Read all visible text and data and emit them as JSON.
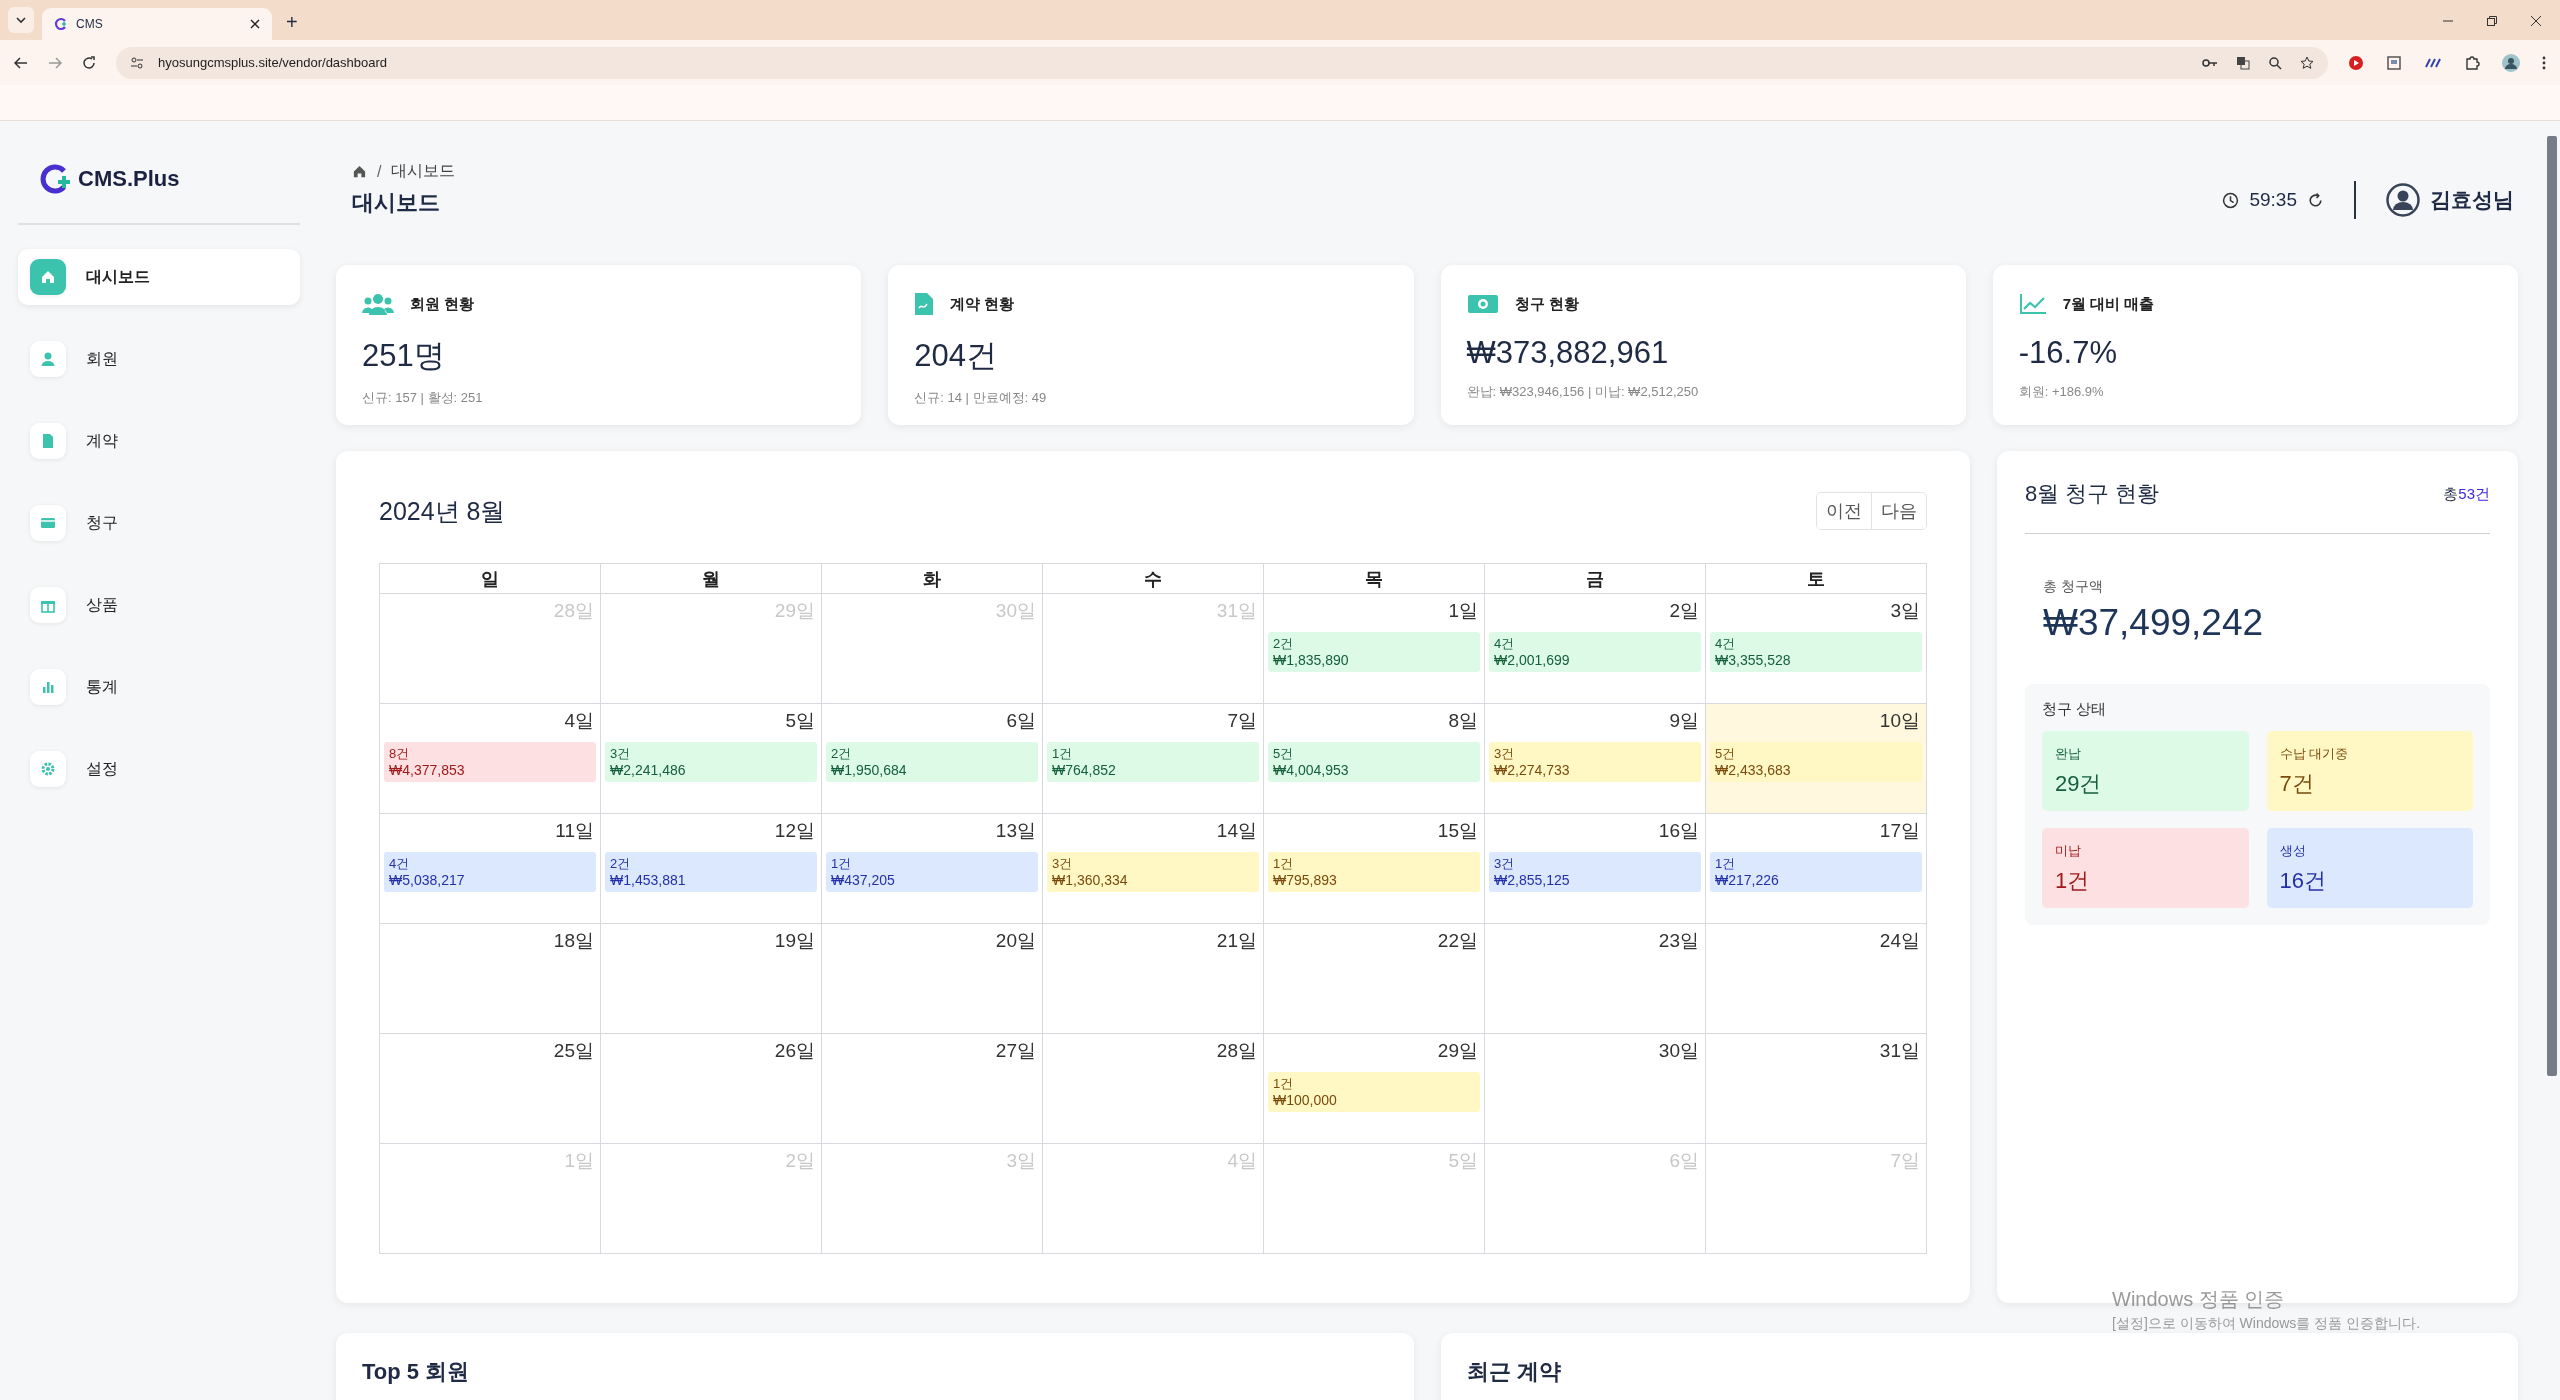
{
  "browser": {
    "tab_title": "CMS",
    "new_tab": "+",
    "url": "hyosungcmsplus.site/vendor/dashboard"
  },
  "sidebar": {
    "logo": "CMS.Plus",
    "items": [
      {
        "label": "대시보드",
        "selected": true
      },
      {
        "label": "회원",
        "selected": false
      },
      {
        "label": "계약",
        "selected": false
      },
      {
        "label": "청구",
        "selected": false
      },
      {
        "label": "상품",
        "selected": false
      },
      {
        "label": "통계",
        "selected": false
      },
      {
        "label": "설정",
        "selected": false
      }
    ]
  },
  "header": {
    "breadcrumb": "대시보드",
    "separator": "/",
    "title": "대시보드",
    "timer": "59:35",
    "user": "김효성님"
  },
  "stats": [
    {
      "title": "회원 현황",
      "value": "251명",
      "sub": "신규: 157 | 활성: 251"
    },
    {
      "title": "계약 현황",
      "value": "204건",
      "sub": "신규: 14 | 만료예정: 49"
    },
    {
      "title": "청구 현황",
      "value": "₩373,882,961",
      "sub": "완납: ₩323,946,156 | 미납: ₩2,512,250"
    },
    {
      "title": "7월 대비 매출",
      "value": "-16.7%",
      "sub": "회원: +186.9%"
    }
  ],
  "calendar": {
    "title": "2024년 8월",
    "prev": "이전",
    "next": "다음",
    "weekdays": [
      "일",
      "월",
      "화",
      "수",
      "목",
      "금",
      "토"
    ],
    "weeks": [
      [
        {
          "day": "28일",
          "in_month": false,
          "today": false
        },
        {
          "day": "29일",
          "in_month": false,
          "today": false
        },
        {
          "day": "30일",
          "in_month": false,
          "today": false
        },
        {
          "day": "31일",
          "in_month": false,
          "today": false
        },
        {
          "day": "1일",
          "in_month": true,
          "today": false,
          "event": {
            "count": "2건",
            "amount": "₩1,835,890",
            "kind": "paid"
          }
        },
        {
          "day": "2일",
          "in_month": true,
          "today": false,
          "event": {
            "count": "4건",
            "amount": "₩2,001,699",
            "kind": "paid"
          }
        },
        {
          "day": "3일",
          "in_month": true,
          "today": false,
          "event": {
            "count": "4건",
            "amount": "₩3,355,528",
            "kind": "paid"
          }
        }
      ],
      [
        {
          "day": "4일",
          "in_month": true,
          "today": false,
          "event": {
            "count": "8건",
            "amount": "₩4,377,853",
            "kind": "unpaid"
          }
        },
        {
          "day": "5일",
          "in_month": true,
          "today": false,
          "event": {
            "count": "3건",
            "amount": "₩2,241,486",
            "kind": "paid"
          }
        },
        {
          "day": "6일",
          "in_month": true,
          "today": false,
          "event": {
            "count": "2건",
            "amount": "₩1,950,684",
            "kind": "paid"
          }
        },
        {
          "day": "7일",
          "in_month": true,
          "today": false,
          "event": {
            "count": "1건",
            "amount": "₩764,852",
            "kind": "paid"
          }
        },
        {
          "day": "8일",
          "in_month": true,
          "today": false,
          "event": {
            "count": "5건",
            "amount": "₩4,004,953",
            "kind": "paid"
          }
        },
        {
          "day": "9일",
          "in_month": true,
          "today": false,
          "event": {
            "count": "3건",
            "amount": "₩2,274,733",
            "kind": "pending"
          }
        },
        {
          "day": "10일",
          "in_month": true,
          "today": true,
          "event": {
            "count": "5건",
            "amount": "₩2,433,683",
            "kind": "pending"
          }
        }
      ],
      [
        {
          "day": "11일",
          "in_month": true,
          "today": false,
          "event": {
            "count": "4건",
            "amount": "₩5,038,217",
            "kind": "created"
          }
        },
        {
          "day": "12일",
          "in_month": true,
          "today": false,
          "event": {
            "count": "2건",
            "amount": "₩1,453,881",
            "kind": "created"
          }
        },
        {
          "day": "13일",
          "in_month": true,
          "today": false,
          "event": {
            "count": "1건",
            "amount": "₩437,205",
            "kind": "created"
          }
        },
        {
          "day": "14일",
          "in_month": true,
          "today": false,
          "event": {
            "count": "3건",
            "amount": "₩1,360,334",
            "kind": "pending"
          }
        },
        {
          "day": "15일",
          "in_month": true,
          "today": false,
          "event": {
            "count": "1건",
            "amount": "₩795,893",
            "kind": "pending"
          }
        },
        {
          "day": "16일",
          "in_month": true,
          "today": false,
          "event": {
            "count": "3건",
            "amount": "₩2,855,125",
            "kind": "created"
          }
        },
        {
          "day": "17일",
          "in_month": true,
          "today": false,
          "event": {
            "count": "1건",
            "amount": "₩217,226",
            "kind": "created"
          }
        }
      ],
      [
        {
          "day": "18일",
          "in_month": true,
          "today": false
        },
        {
          "day": "19일",
          "in_month": true,
          "today": false
        },
        {
          "day": "20일",
          "in_month": true,
          "today": false
        },
        {
          "day": "21일",
          "in_month": true,
          "today": false
        },
        {
          "day": "22일",
          "in_month": true,
          "today": false
        },
        {
          "day": "23일",
          "in_month": true,
          "today": false
        },
        {
          "day": "24일",
          "in_month": true,
          "today": false
        }
      ],
      [
        {
          "day": "25일",
          "in_month": true,
          "today": false
        },
        {
          "day": "26일",
          "in_month": true,
          "today": false
        },
        {
          "day": "27일",
          "in_month": true,
          "today": false
        },
        {
          "day": "28일",
          "in_month": true,
          "today": false
        },
        {
          "day": "29일",
          "in_month": true,
          "today": false,
          "event": {
            "count": "1건",
            "amount": "₩100,000",
            "kind": "pending"
          }
        },
        {
          "day": "30일",
          "in_month": true,
          "today": false
        },
        {
          "day": "31일",
          "in_month": true,
          "today": false
        }
      ],
      [
        {
          "day": "1일",
          "in_month": false,
          "today": false
        },
        {
          "day": "2일",
          "in_month": false,
          "today": false
        },
        {
          "day": "3일",
          "in_month": false,
          "today": false
        },
        {
          "day": "4일",
          "in_month": false,
          "today": false
        },
        {
          "day": "5일",
          "in_month": false,
          "today": false
        },
        {
          "day": "6일",
          "in_month": false,
          "today": false
        },
        {
          "day": "7일",
          "in_month": false,
          "today": false
        }
      ]
    ]
  },
  "billing": {
    "title": "8월 청구 현황",
    "total_label": "총",
    "total_count": "53건",
    "amount_label": "총 청구액",
    "amount": "₩37,499,242",
    "status_title": "청구 상태",
    "statuses": [
      {
        "label": "완납",
        "count": "29건",
        "kind": "paid"
      },
      {
        "label": "수납 대기중",
        "count": "7건",
        "kind": "pending"
      },
      {
        "label": "미납",
        "count": "1건",
        "kind": "unpaid"
      },
      {
        "label": "생성",
        "count": "16건",
        "kind": "created"
      }
    ]
  },
  "bottom_cards": [
    {
      "title": "Top 5 회원"
    },
    {
      "title": "최근 계약"
    }
  ],
  "os_notice": {
    "title": "Windows 정품 인증",
    "text": "[설정]으로 이동하여 Windows를 정품 인증합니다."
  }
}
